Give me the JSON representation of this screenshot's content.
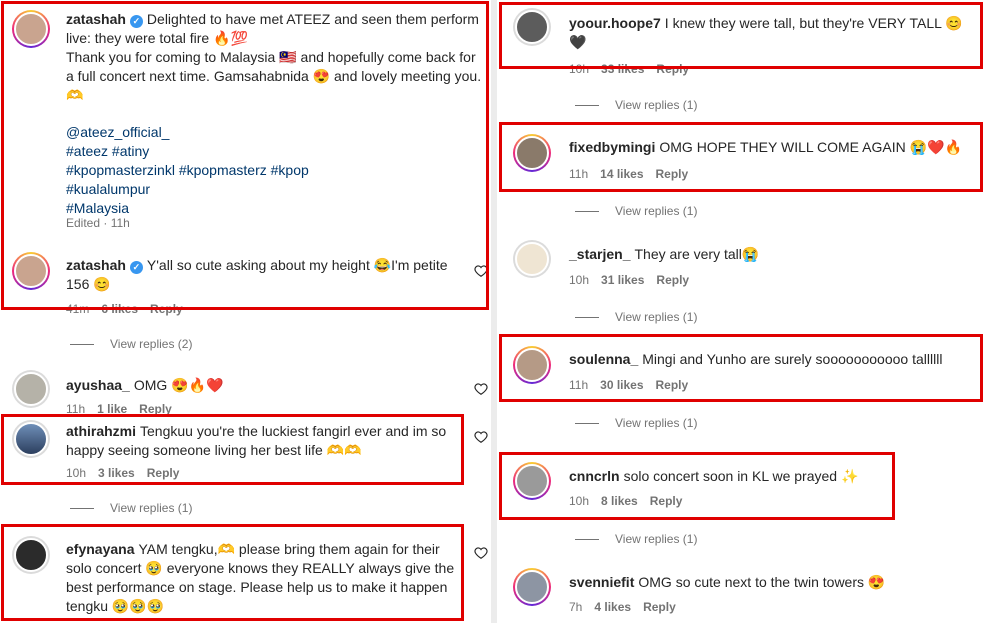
{
  "colors": {
    "highlight": "#e00000",
    "link": "#00376b",
    "muted": "#737373",
    "verified": "#3897f0"
  },
  "left": {
    "c1": {
      "username": "zatashah",
      "line1": "Delighted to have met ATEEZ and seen them perform",
      "line2": "live: they were total fire 🔥💯",
      "line3": "Thank you for coming to Malaysia 🇲🇾 and hopefully come back for",
      "line4": "a full concert next time. Gamsahabnida 😍 and lovely meeting you.",
      "line5": "🫶",
      "tags": [
        "@ateez_official_",
        "#ateez #atiny",
        "#kpopmasterzinkl #kpopmasterz #kpop",
        "#kualalumpur",
        "#Malaysia"
      ],
      "meta": "Edited · 11h"
    },
    "c2": {
      "username": "zatashah",
      "line1": "Y'all so cute asking about my height 😂I'm petite",
      "line2": "156 😊",
      "time": "41m",
      "likes": "6 likes",
      "reply": "Reply"
    },
    "vr1": "View replies (2)",
    "c3": {
      "username": "ayushaa_",
      "text": "OMG 😍🔥❤️",
      "time": "11h",
      "likes": "1 like",
      "reply": "Reply"
    },
    "c4": {
      "username": "athirahzmi",
      "line1": "Tengkuu you're the luckiest fangirl ever and im so",
      "line2": "happy seeing someone living her best life 🫶🫶",
      "time": "10h",
      "likes": "3 likes",
      "reply": "Reply"
    },
    "vr2": "View replies (1)",
    "c5": {
      "username": "efynayana",
      "line1": "YAM tengku,🫶 please bring them again for their",
      "line2": "solo concert 🥹 everyone knows they REALLY always give the",
      "line3": "best performance on stage. Please help us to make it happen",
      "line4": "tengku 🥹🥹🥹"
    }
  },
  "right": {
    "c1": {
      "username": "yoour.hoope7",
      "line1": "I knew they were tall, but they're VERY TALL 😊",
      "line2": "🖤",
      "time": "10h",
      "likes": "33 likes",
      "reply": "Reply"
    },
    "vr1": "View replies (1)",
    "c2": {
      "username": "fixedbymingi",
      "text": "OMG HOPE THEY WILL COME AGAIN 😭❤️🔥",
      "time": "11h",
      "likes": "14 likes",
      "reply": "Reply"
    },
    "vr2": "View replies (1)",
    "c3": {
      "username": "_starjen_",
      "text": "They are very tall😭",
      "time": "10h",
      "likes": "31 likes",
      "reply": "Reply"
    },
    "vr3": "View replies (1)",
    "c4": {
      "username": "soulenna_",
      "text": "Mingi and Yunho are surely sooooooooooo tallllll",
      "time": "11h",
      "likes": "30 likes",
      "reply": "Reply"
    },
    "vr4": "View replies (1)",
    "c5": {
      "username": "cnncrln",
      "text": "solo concert soon in KL we prayed ✨",
      "time": "10h",
      "likes": "8 likes",
      "reply": "Reply"
    },
    "vr5": "View replies (1)",
    "c6": {
      "username": "svenniefit",
      "text": "OMG so cute next to the twin towers 😍",
      "time": "7h",
      "likes": "4 likes",
      "reply": "Reply"
    }
  }
}
